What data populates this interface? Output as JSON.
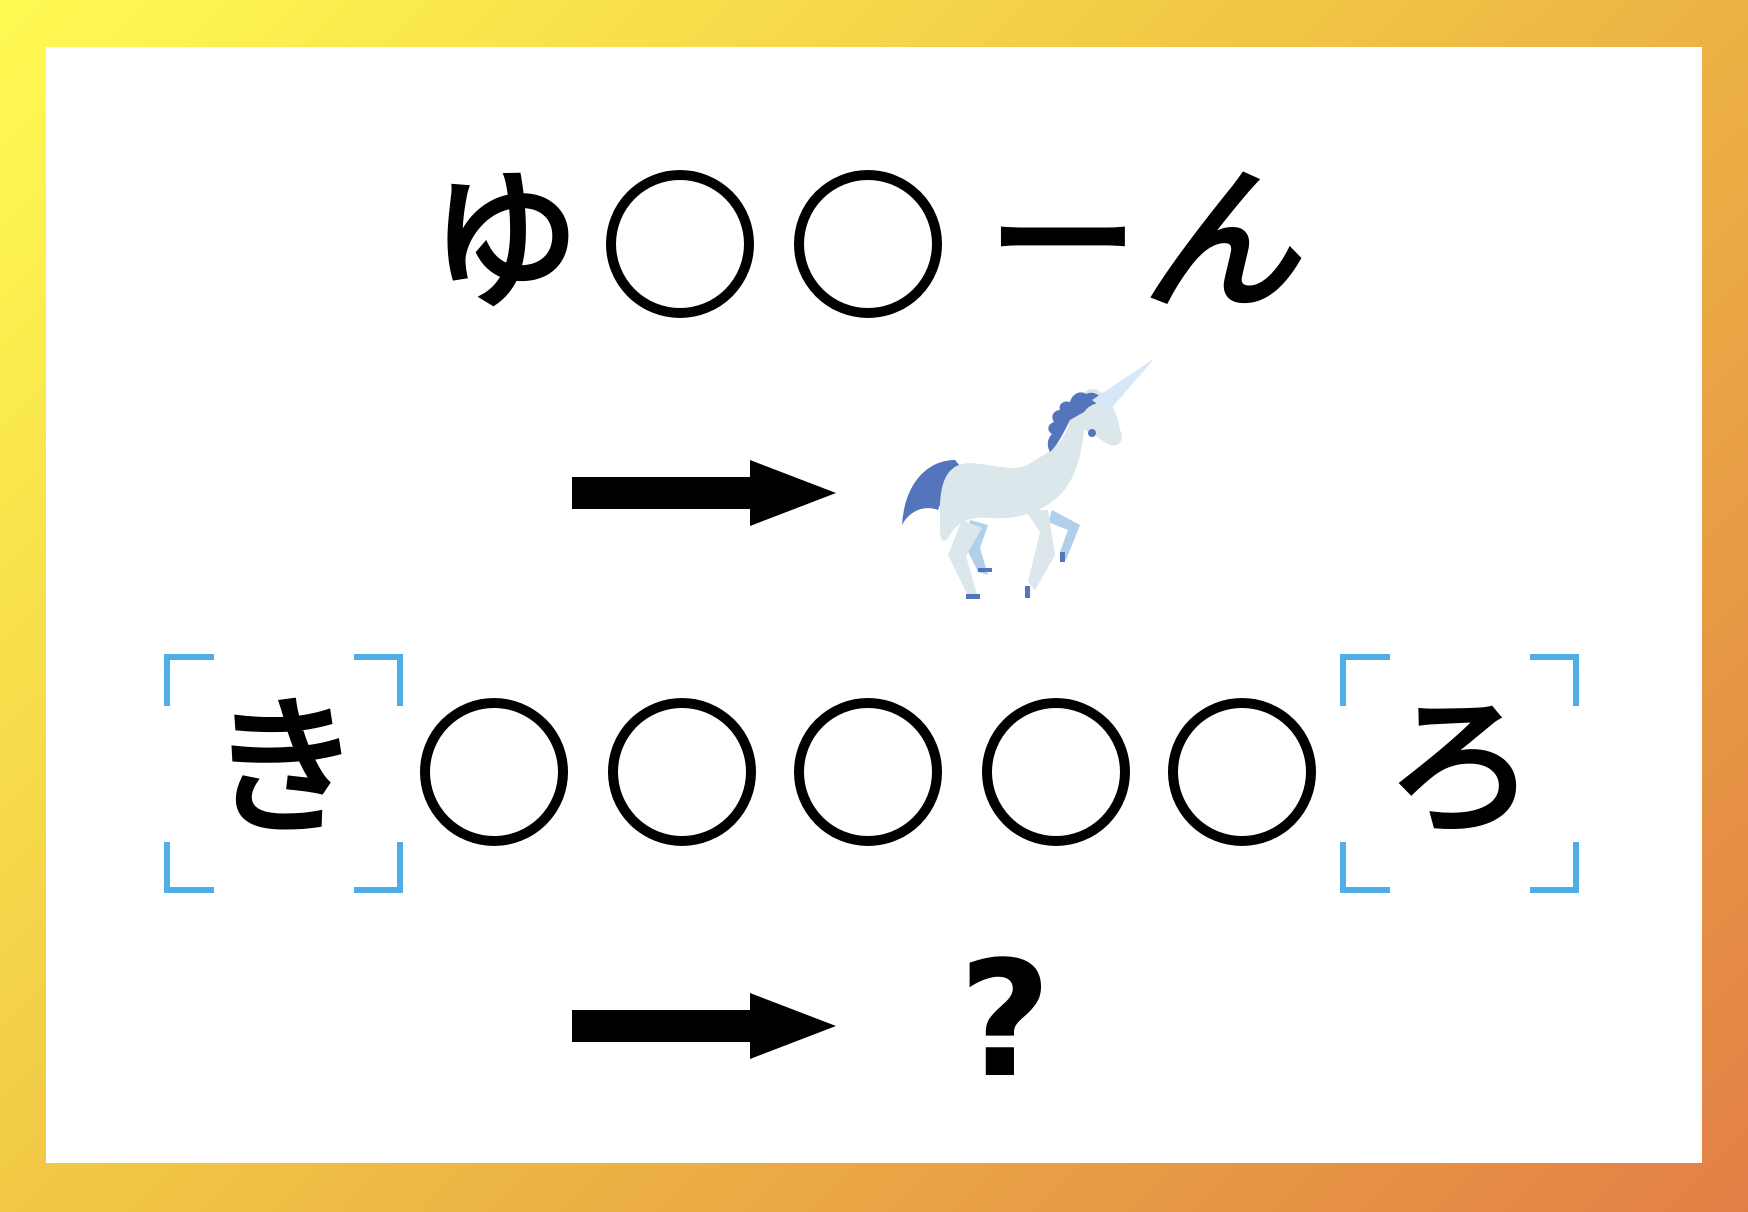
{
  "quiz": {
    "example": {
      "first_char": "ゆ",
      "dash": "ー",
      "last_char": "ん",
      "hidden_count": 2,
      "hint_icon": "unicorn-icon"
    },
    "question": {
      "first_char": "き",
      "last_char": "ろ",
      "hidden_count": 5,
      "answer_mark": "?"
    },
    "arrow_icon": "right-arrow-icon"
  },
  "colors": {
    "bracket": "#4DAEE8",
    "frame_start": "#FFFB52",
    "frame_end": "#E27F45",
    "unicorn_body": "#DCE7EC",
    "unicorn_mane": "#5475BB"
  }
}
